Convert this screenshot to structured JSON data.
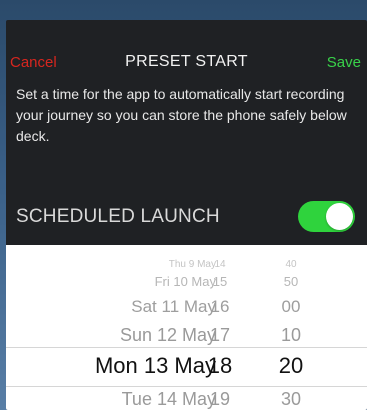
{
  "navbar": {
    "cancel_label": "Cancel",
    "title": "PRESET START",
    "save_label": "Save"
  },
  "description": "Set a time for the app to automatically start recording your journey so you can store the phone safely below deck.",
  "scheduled_launch": {
    "label": "SCHEDULED LAUNCH",
    "enabled": true
  },
  "colors": {
    "cancel": "#d7261f",
    "save": "#39d24a",
    "toggle_on": "#2fd33d"
  },
  "picker": {
    "rows": [
      {
        "date": "Thu 9 May",
        "hour": "14",
        "minute": "40"
      },
      {
        "date": "Fri 10 May",
        "hour": "15",
        "minute": "50"
      },
      {
        "date": "Sat 11 May",
        "hour": "16",
        "minute": "00"
      },
      {
        "date": "Sun 12 May",
        "hour": "17",
        "minute": "10"
      },
      {
        "date": "Mon 13 May",
        "hour": "18",
        "minute": "20"
      },
      {
        "date": "Tue 14 May",
        "hour": "19",
        "minute": "30"
      }
    ],
    "selected": {
      "date": "Mon 13 May",
      "hour": "18",
      "minute": "20"
    }
  }
}
